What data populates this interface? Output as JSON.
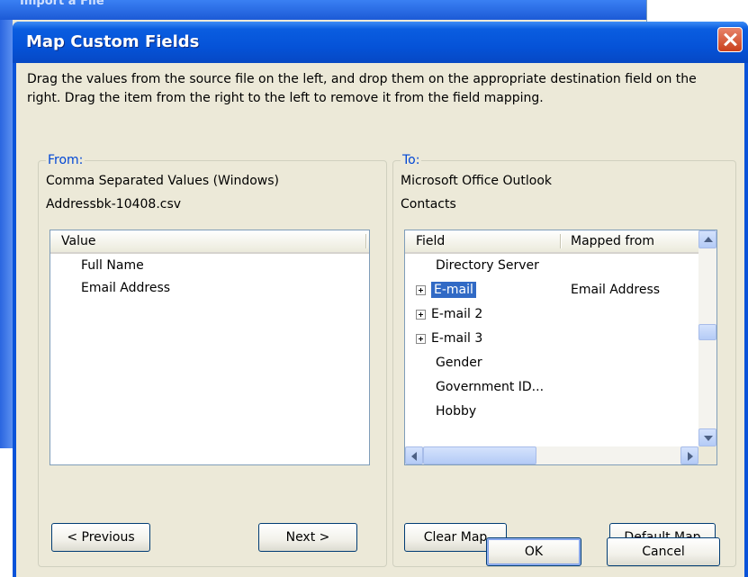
{
  "background_window": {
    "title": "Import a File"
  },
  "dialog": {
    "title": "Map Custom Fields",
    "instructions": "Drag the values from the source file on the left, and drop them on the appropriate destination field on the right.  Drag the item from the right to the left to remove it from the field mapping."
  },
  "from": {
    "label": "From:",
    "source_type": "Comma Separated Values (Windows)",
    "file_name": "Addressbk-10408.csv",
    "column_header": "Value",
    "items": [
      "Full Name",
      "Email Address"
    ],
    "previous_label": "< Previous",
    "next_label": "Next >"
  },
  "to": {
    "label": "To:",
    "app": "Microsoft Office Outlook",
    "folder": "Contacts",
    "column_field": "Field",
    "column_mapped": "Mapped from",
    "rows": [
      {
        "field": "Directory Server",
        "mapped": "",
        "expandable": false
      },
      {
        "field": "E-mail",
        "mapped": "Email Address",
        "expandable": true,
        "selected": true
      },
      {
        "field": "E-mail 2",
        "mapped": "",
        "expandable": true
      },
      {
        "field": "E-mail 3",
        "mapped": "",
        "expandable": true
      },
      {
        "field": "Gender",
        "mapped": "",
        "expandable": false
      },
      {
        "field": "Government ID...",
        "mapped": "",
        "expandable": false
      },
      {
        "field": "Hobby",
        "mapped": "",
        "expandable": false
      }
    ],
    "clear_map_label": "Clear Map",
    "default_map_label": "Default Map"
  },
  "buttons": {
    "ok": "OK",
    "cancel": "Cancel"
  },
  "colors": {
    "title_bar": "#0553d8",
    "group_label": "#0046d5",
    "selection": "#316ac5",
    "dialog_bg": "#ece9d8"
  }
}
